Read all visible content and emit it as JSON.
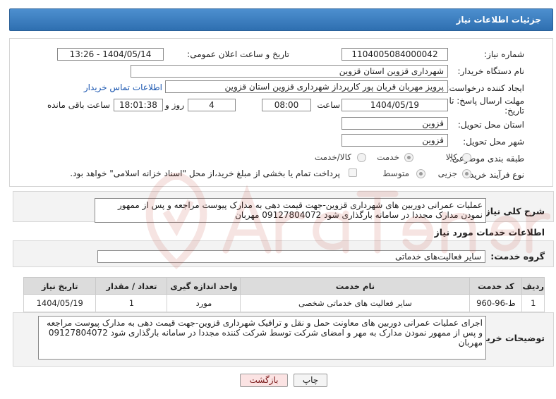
{
  "header": {
    "title": "جزئیات اطلاعات نیاز"
  },
  "form": {
    "need_number": {
      "label": "شماره نیاز:",
      "value": "1104005084000042"
    },
    "announce_datetime": {
      "label": "تاریخ و ساعت اعلان عمومی:",
      "value": "1404/05/14 - 13:26"
    },
    "buyer_org": {
      "label": "نام دستگاه خریدار:",
      "value": "شهرداری قزوین استان قزوین"
    },
    "requester": {
      "label": "ایجاد کننده درخواست:",
      "value": "پرویز مهربان قربان پور کارپرداز شهرداری قزوین استان قزوین",
      "contact_link": "اطلاعات تماس خریدار"
    },
    "deadline": {
      "label_line1": "مهلت ارسال پاسخ: تا",
      "label_line2": "تاریخ:",
      "date": "1404/05/19",
      "time_label": "ساعت",
      "time": "08:00",
      "days": "4",
      "days_label": "روز و",
      "remaining": "18:01:38",
      "remaining_label": "ساعت باقی مانده"
    },
    "delivery_province": {
      "label": "استان محل تحویل:",
      "value": "قزوین"
    },
    "delivery_city": {
      "label": "شهر محل تحویل:",
      "value": "قزوین"
    },
    "category": {
      "label": "طبقه بندی موضوعی:",
      "options": [
        "کالا",
        "خدمت",
        "کالا/خدمت"
      ],
      "selected": "خدمت"
    },
    "purchase_type": {
      "label": "نوع فرآیند خرید :",
      "options": [
        "جزیی",
        "متوسط"
      ],
      "selected": "جزیی",
      "payment_note": "پرداخت تمام یا بخشی از مبلغ خرید،از محل \"اسناد خزانه اسلامی\" خواهد بود."
    }
  },
  "summary": {
    "label": "شرح کلی نیاز:",
    "text": "عملیات عمرانی دوربین های شهرداری قزوین-جهت قیمت دهی به مدارک پیوست مراجعه و پس از ممهور نمودن مدارک مجددا در سامانه بارگذاری شود 09127804072 مهربان"
  },
  "services": {
    "section_title": "اطلاعات خدمات مورد نیاز",
    "group_label": "گروه خدمت:",
    "group_value": "سایر فعالیت‌های خدماتی",
    "columns": [
      "ردیف",
      "کد خدمت",
      "نام خدمت",
      "واحد اندازه گیری",
      "تعداد / مقدار",
      "تاریخ نیاز"
    ],
    "rows": [
      [
        "1",
        "ط-96-960",
        "سایر فعالیت های خدماتی شخصی",
        "مورد",
        "1",
        "1404/05/19"
      ]
    ]
  },
  "buyer_notes": {
    "label": "توضیحات خریدار:",
    "text": "اجرای عملیات عمرانی دوربین های معاونت حمل و نقل و ترافیک شهرداری قزوین-جهت قیمت دهی به مدارک پیوست مراجعه و پس از ممهور نمودن مدارک به مهر و امضای شرکت توسط شرکت کننده مجددا در سامانه بارگذاری شود 09127804072 مهربان"
  },
  "buttons": {
    "print": "چاپ",
    "back": "بازگشت"
  },
  "colors": {
    "header_blue": "#3a7cc0",
    "back_button_bg": "#fbe3e3",
    "link_blue": "#1a56b0",
    "watermark_red": "#c0392b"
  }
}
